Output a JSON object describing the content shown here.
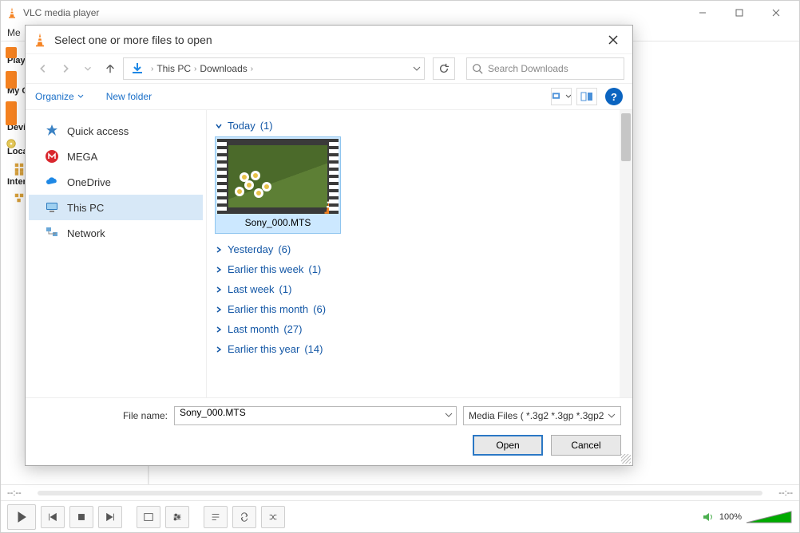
{
  "vlc": {
    "title": "VLC media player",
    "menubar_snippet": "Me",
    "sidebar": {
      "playlist_header": "Play",
      "my_computer_header": "My C",
      "devices_header": "Devi",
      "local_network_header": "Loca",
      "internet_header": "Inter"
    },
    "seek": {
      "left": "--:--",
      "right": "--:--"
    },
    "volume": {
      "percent": "100%"
    }
  },
  "dialog": {
    "title": "Select one or more files to open",
    "breadcrumb": {
      "root": "This PC",
      "folder": "Downloads"
    },
    "search_placeholder": "Search Downloads",
    "toolbar": {
      "organize": "Organize",
      "new_folder": "New folder"
    },
    "tree": {
      "quick_access": "Quick access",
      "mega": "MEGA",
      "onedrive": "OneDrive",
      "this_pc": "This PC",
      "network": "Network"
    },
    "groups": [
      {
        "label": "Today",
        "count": "(1)",
        "expanded": true
      },
      {
        "label": "Yesterday",
        "count": "(6)",
        "expanded": false
      },
      {
        "label": "Earlier this week",
        "count": "(1)",
        "expanded": false
      },
      {
        "label": "Last week",
        "count": "(1)",
        "expanded": false
      },
      {
        "label": "Earlier this month",
        "count": "(6)",
        "expanded": false
      },
      {
        "label": "Last month",
        "count": "(27)",
        "expanded": false
      },
      {
        "label": "Earlier this year",
        "count": "(14)",
        "expanded": false
      }
    ],
    "selected_file": {
      "name": "Sony_000.MTS"
    },
    "footer": {
      "file_name_label": "File name:",
      "file_name_value": "Sony_000.MTS",
      "type_filter": "Media Files ( *.3g2 *.3gp *.3gp2",
      "open": "Open",
      "cancel": "Cancel"
    }
  }
}
